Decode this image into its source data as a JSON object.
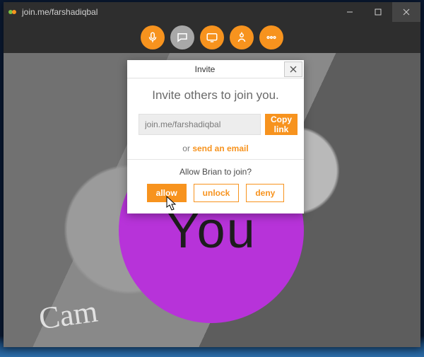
{
  "colors": {
    "accent": "#f7931e",
    "you_circle": "#b733d9"
  },
  "titlebar": {
    "url": "join.me/farshadiqbal"
  },
  "content": {
    "you_label": "You",
    "handwriting": "Cam"
  },
  "modal": {
    "title": "Invite",
    "headline": "Invite others to join you.",
    "link_value": "join.me/farshadiqbal",
    "copy_label": "Copy link",
    "or_text": "or ",
    "email_link": "send an email",
    "allow_question": "Allow Brian to join?",
    "allow": "allow",
    "unlock": "unlock",
    "deny": "deny"
  }
}
